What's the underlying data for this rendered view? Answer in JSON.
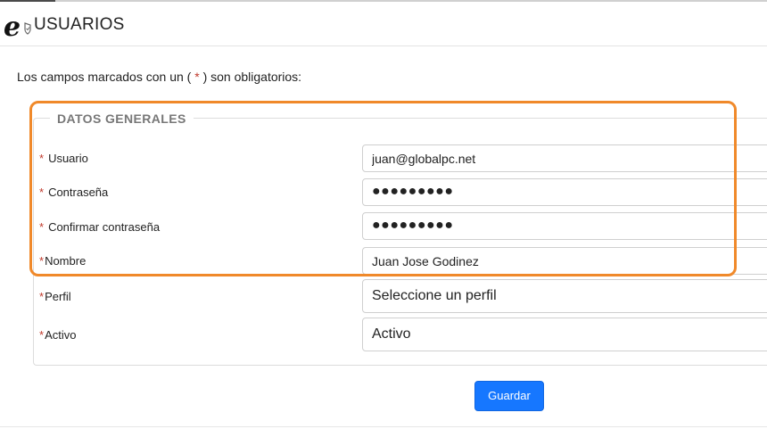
{
  "header": {
    "title": "USUARIOS",
    "logo_icon": "e-shield-logo-icon"
  },
  "form": {
    "required_note_prefix": "Los campos marcados con un (",
    "required_note_star": " * ",
    "required_note_suffix": ") son obligatorios:",
    "section_title": "DATOS GENERALES",
    "fields": {
      "usuario": {
        "label": "Usuario",
        "value": "juan@globalpc.net"
      },
      "contrasena": {
        "label": "Contraseña",
        "value": "●●●●●●●●●"
      },
      "confirmar": {
        "label": "Confirmar contraseña",
        "value": "●●●●●●●●●"
      },
      "nombre": {
        "label": "Nombre",
        "value": "Juan Jose Godinez"
      },
      "perfil": {
        "label": "Perfil",
        "value": "Seleccione un perfil"
      },
      "activo": {
        "label": "Activo",
        "value": "Activo"
      }
    },
    "required_star": "*",
    "save_label": "Guardar"
  },
  "colors": {
    "highlight": "#f0892a",
    "primary_button": "#1677ff",
    "required_star": "#c0392b"
  }
}
